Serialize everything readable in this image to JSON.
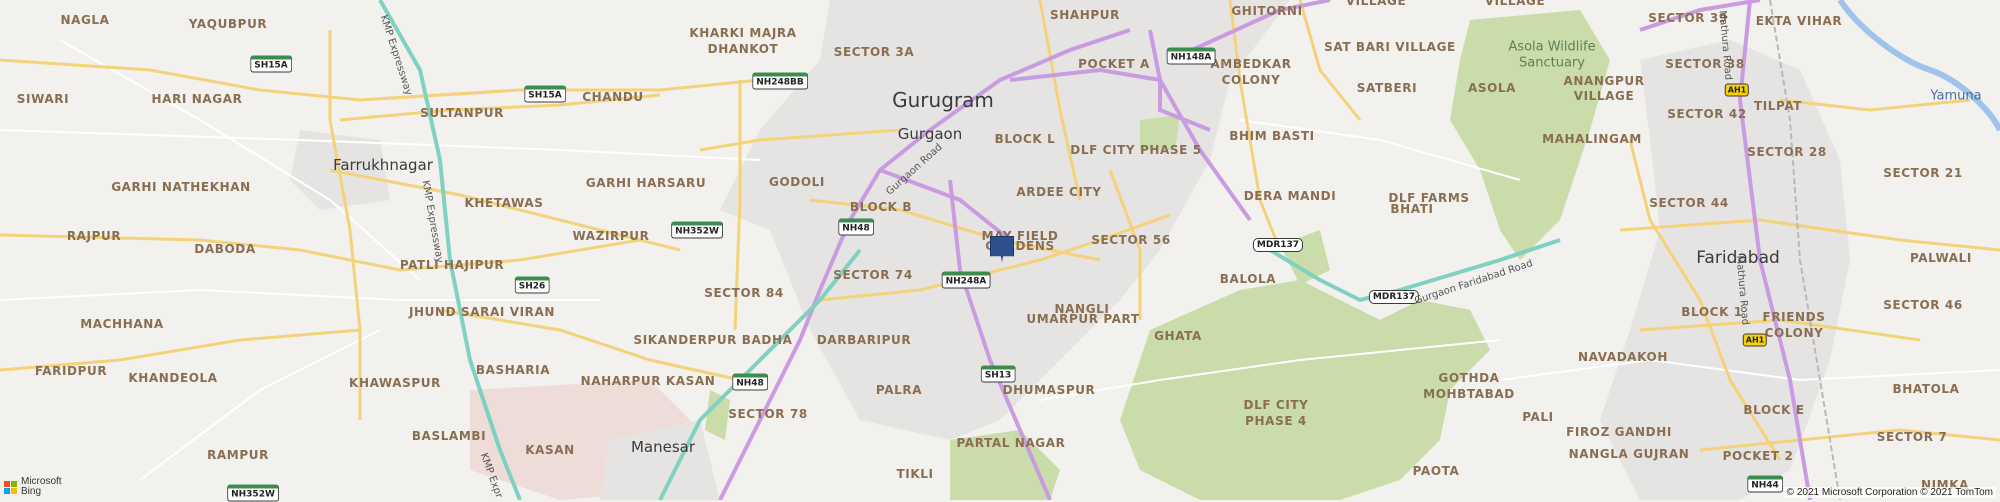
{
  "colors": {
    "land": "#f2f1ee",
    "urban": "#e6e4e2",
    "forest": "#c9dca9",
    "major_road": "#f3d27a",
    "highway": "#c99be0",
    "expressway": "#7fd1c2",
    "river": "#9fc4ea",
    "dense": "#eedcd8",
    "pin": "#2e4f8e"
  },
  "map": {
    "cities": [
      {
        "name": "Gurugram",
        "size": "big"
      },
      {
        "name": "Gurgaon",
        "size": "sm"
      },
      {
        "name": "Farrukhnagar",
        "size": "sm"
      },
      {
        "name": "Faridabad",
        "size": "med"
      },
      {
        "name": "Manesar",
        "size": "sm"
      }
    ],
    "localities": [
      "NAGLA",
      "YAQUBPUR",
      "KHARKI MAJRA",
      "DHANKOT",
      "SECTOR 3A",
      "SHAHPUR",
      "POCKET A",
      "GHITORNI",
      "VILLAGE",
      "SECTOR 39",
      "EKTA VIHAR",
      "SIWARI",
      "HARI NAGAR",
      "CHANDU",
      "AMBEDKAR",
      "COLONY",
      "SAT BARI VILLAGE",
      "SECTOR 38",
      "SULTANPUR",
      "SATBERI",
      "ASOLA",
      "ANANGPUR",
      "TILPAT",
      "BLOCK L",
      "BHIM BASTI",
      "SECTOR 42",
      "MAHALINGAM",
      "SECTOR 28",
      "GARHI NATHEKHAN",
      "GARHI HARSARU",
      "GODOLI",
      "DLF CITY PHASE 5",
      "ARDEE CITY",
      "DERA MANDI",
      "DLF FARMS",
      "KHETAWAS",
      "BLOCK B",
      "SECTOR 44",
      "RAJPUR",
      "WAZIRPUR",
      "MAY FIELD",
      "GARDENS",
      "BHATI",
      "DABODA",
      "SECTOR 56",
      "PALWALI",
      "PATLI HAJIPUR",
      "SECTOR 74",
      "BALOLA",
      "SECTOR 84",
      "NANGLI",
      "UMARPUR PART",
      "JHUND SARAI VIRAN",
      "SECTOR 46",
      "BLOCK 1",
      "FRIENDS",
      "MACHHANA",
      "GHATA",
      "BASHARIA",
      "SIKANDERPUR BADHA",
      "DARBARIPUR",
      "FARIDPUR",
      "KHANDEOLA",
      "NAHARPUR KASAN",
      "NAVADAKOH",
      "KHAWASPUR",
      "PALRA",
      "DHUMASPUR",
      "BHATOLA",
      "SECTOR 78",
      "GOTHDA",
      "MOHBTABAD",
      "DLF CITY",
      "PHASE 4",
      "PALI",
      "FIROZ GANDHI",
      "BLOCK E",
      "BASLAMBI",
      "KASAN",
      "PARTAL NAGAR",
      "RAMPUR",
      "NANGLA GUJRAN",
      "POCKET 2",
      "TIKLI",
      "PAOTA",
      "SECTOR 7",
      "NIMKA",
      "VILLAGE",
      "SECTOR 21",
      "VILLAGE",
      "COLONY"
    ],
    "green_labels": [
      "Asola Wildlife",
      "Sanctuary",
      "Yamuna"
    ],
    "route_shields": [
      "SH15A",
      "SH15A",
      "NH248BB",
      "NH148A",
      "NH352W",
      "NH48",
      "NH248A",
      "SH26",
      "NH48",
      "SH13",
      "MDR137",
      "MDR137",
      "NH352W",
      "NH44",
      "AH1",
      "AH1"
    ],
    "road_names": [
      "KMP Expressway",
      "KMP Expressway",
      "KMP Expr",
      "Gurgaon Road",
      "Gurgaon Faridabad Road",
      "Mathura Road",
      "Mathura Road"
    ]
  },
  "attribution": {
    "bing_line1": "Microsoft",
    "bing_line2": "Bing",
    "copyright": "© 2021 Microsoft Corporation © 2021 TomTom"
  }
}
